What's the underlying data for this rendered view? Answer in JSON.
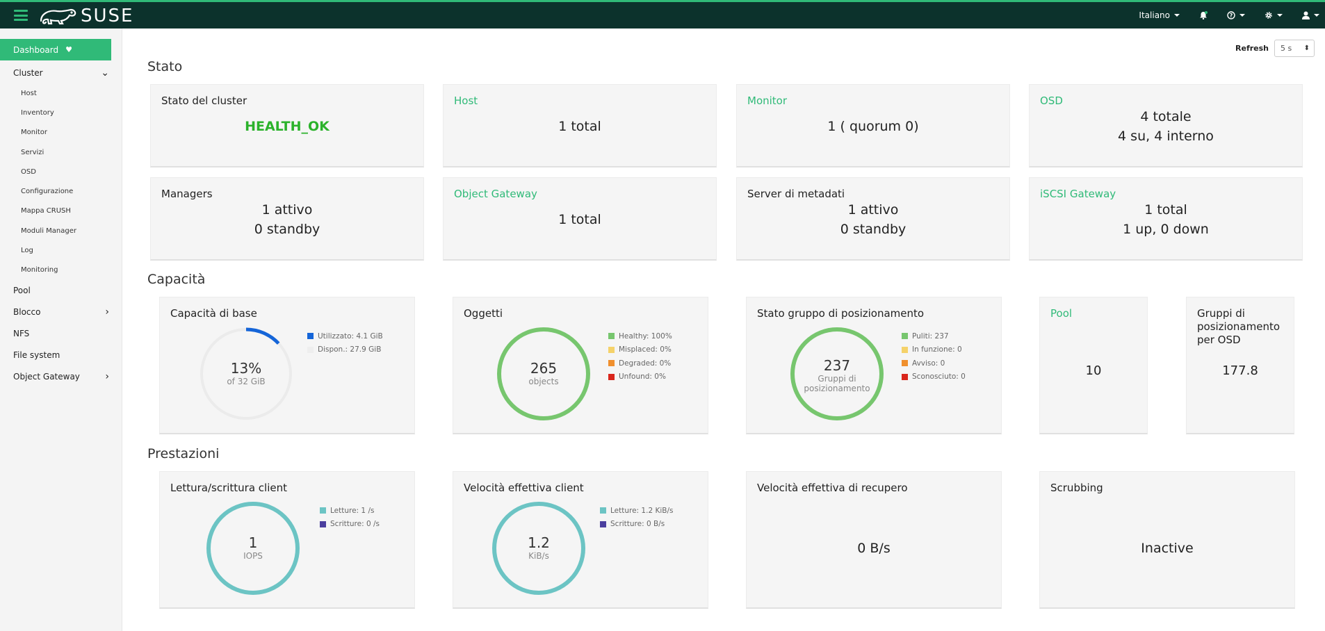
{
  "header": {
    "brand": "SUSE",
    "language": "Italiano"
  },
  "sidebar": {
    "dashboard": "Dashboard",
    "cluster": "Cluster",
    "cluster_items": [
      "Host",
      "Inventory",
      "Monitor",
      "Servizi",
      "OSD",
      "Configurazione",
      "Mappa CRUSH",
      "Moduli Manager",
      "Log",
      "Monitoring"
    ],
    "pool": "Pool",
    "blocco": "Blocco",
    "nfs": "NFS",
    "filesystem": "File system",
    "object_gateway": "Object Gateway"
  },
  "refresh": {
    "label": "Refresh",
    "value": "5 s"
  },
  "sections": {
    "stato": "Stato",
    "capacita": "Capacità",
    "prestazioni": "Prestazioni"
  },
  "stato": {
    "cluster": {
      "title": "Stato del cluster",
      "value": "HEALTH_OK"
    },
    "host": {
      "title": "Host",
      "value": "1 total"
    },
    "monitor": {
      "title": "Monitor",
      "value": "1 ( quorum 0)"
    },
    "osd": {
      "title": "OSD",
      "line1": "4 totale",
      "line2": "4 su, 4 interno"
    },
    "managers": {
      "title": "Managers",
      "line1": "1 attivo",
      "line2": "0 standby"
    },
    "object_gateway": {
      "title": "Object Gateway",
      "value": "1 total"
    },
    "mds": {
      "title": "Server di metadati",
      "line1": "1 attivo",
      "line2": "0 standby"
    },
    "iscsi": {
      "title": "iSCSI Gateway",
      "line1": "1 total",
      "line2": "1 up, 0 down"
    }
  },
  "capacita": {
    "raw": {
      "title": "Capacità di base",
      "percent": "13%",
      "sub": "of 32 GiB",
      "used_fraction": 0.13,
      "legend": [
        "Utilizzato: 4.1 GiB",
        "Dispon.: 27.9 GiB"
      ],
      "colors": [
        "#1565d8",
        "#eeeeee"
      ]
    },
    "objects": {
      "title": "Oggetti",
      "value": "265",
      "sub": "objects",
      "legend": [
        "Healthy: 100%",
        "Misplaced: 0%",
        "Degraded: 0%",
        "Unfound: 0%"
      ],
      "colors": [
        "#77c66e",
        "#f5d26a",
        "#f0902e",
        "#d9261c"
      ]
    },
    "pg": {
      "title": "Stato gruppo di posizionamento",
      "value": "237",
      "sub1": "Gruppi di",
      "sub2": "posizionamento",
      "legend": [
        "Puliti: 237",
        "In funzione: 0",
        "Avviso: 0",
        "Sconosciuto: 0"
      ],
      "colors": [
        "#77c66e",
        "#f5d26a",
        "#f0902e",
        "#d9261c"
      ]
    },
    "pools": {
      "title": "Pool",
      "value": "10"
    },
    "pg_per_osd": {
      "title_line1": "Gruppi di",
      "title_line2": "posizionamento",
      "title_line3": "per OSD",
      "value": "177.8"
    }
  },
  "prestazioni": {
    "iops": {
      "title": "Lettura/scrittura client",
      "value": "1",
      "sub": "IOPS",
      "legend": [
        "Letture: 1 /s",
        "Scritture: 0 /s"
      ],
      "colors": [
        "#6cc4c4",
        "#4b3f9e"
      ]
    },
    "throughput": {
      "title": "Velocità effettiva client",
      "value": "1.2",
      "sub": "KiB/s",
      "legend": [
        "Letture: 1.2 KiB/s",
        "Scritture: 0 B/s"
      ],
      "colors": [
        "#6cc4c4",
        "#4b3f9e"
      ]
    },
    "recovery": {
      "title": "Velocità effettiva di recupero",
      "value": "0 B/s"
    },
    "scrubbing": {
      "title": "Scrubbing",
      "value": "Inactive"
    }
  },
  "theme": {
    "accent": "#30ba78",
    "topbar": "#0c322c"
  }
}
